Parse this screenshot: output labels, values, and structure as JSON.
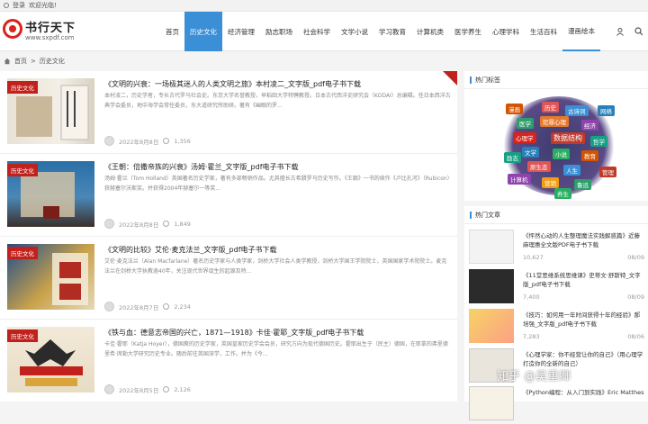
{
  "topbar": {
    "login": "登录",
    "welcome": "欢迎光临!"
  },
  "site": {
    "name": "书行天下",
    "url": "www.sxpdf.com"
  },
  "nav": [
    "首页",
    "历史文化",
    "经济管理",
    "励志职场",
    "社会科学",
    "文学小说",
    "学习教育",
    "计算机类",
    "医学养生",
    "心理学科",
    "生活百科",
    "漫画绘本"
  ],
  "breadcrumb": {
    "home": "首页",
    "current": "历史文化"
  },
  "posts": [
    {
      "category": "历史文化",
      "title": "《文明的兴衰：一场极其迷人的人类文明之旅》本村凌二_文字版_pdf电子书下载",
      "desc": "本村凌二，历史学者，专长古代罗马社会史。东京大学名誉教授，早稻田大学特聘教授。日本古代西洋史研究会（KODAI）总编辑。任日本西洋古典学会委员，地中海学会常任委员，东大道研究所助研。著有《幽眼的罗...",
      "date": "2022年8月8日",
      "views": "1,356"
    },
    {
      "category": "历史文化",
      "title": "《王朝：倍撒帝族的兴衰》汤姆·霍兰_文字版_pdf电子书下载",
      "desc": "汤姆·霍兰（Tom Holland）英国著名历史学家，著有多部畅销作品。尤其擅长古希腊罗马历史写作。《王朝》一书的续作《卢比孔河》（Rubicon）获赫塞尔沃斯奖。并获得2004年赫塞尔一等奖...",
      "date": "2022年8月8日",
      "views": "1,849"
    },
    {
      "category": "历史文化",
      "title": "《文明的比较》艾伦·麦克法兰_文字版_pdf电子书下载",
      "desc": "艾伦·麦克法兰（Alan Macfarlane）著名历史学家与人类学家，剑桥大学社会人类学教授，剑桥大学国王学院院士，英国国家学术院院士。麦克法兰在剑桥大学执教逾40年，关注现代世界诞生的起源及特...",
      "date": "2022年8月7日",
      "views": "2,234"
    },
    {
      "category": "历史文化",
      "title": "《铁与血：德意志帝国的兴亡，1871—1918》卡佳·霍耶_文字版_pdf电子书下载",
      "desc": "卡佳·霍耶（Katja Hoyer），德国裔的历史学家，英国皇家历史学会会员，研究方向为现代德国历史。霍耶出生于（民主）德国，在耶拿的弗里德里希·席勒大学研究历史专业。随后前往英国深学，工作。并为《今...",
      "date": "2022年8月5日",
      "views": "2,126"
    }
  ],
  "sidebar": {
    "tags_title": "热门标签",
    "tags": [
      "历史",
      "古诗词",
      "犯罪心理",
      "医学",
      "经济",
      "心理学",
      "数据结构",
      "哲学",
      "文学",
      "小说",
      "教育",
      "原生态",
      "人生",
      "计算机",
      "营销",
      "鲁迅",
      "管理",
      "励志",
      "网络",
      "漫画",
      "养生"
    ],
    "articles_title": "热门文章",
    "articles": [
      {
        "title": "《怦然心动的人生整理魔法实践解惑篇》近藤麻理惠全文版PDF电子书下载",
        "views": "10,627",
        "date": "08/09"
      },
      {
        "title": "《11堂思维系统思维课》史蒂文·舒斯特_文字版_pdf电子书下载",
        "views": "7,400",
        "date": "08/09"
      },
      {
        "title": "《技巧：如何用一年时间获得十年的经验》郝培强_文字版_pdf电子书下载",
        "views": "7,283",
        "date": "08/06"
      },
      {
        "title": "《心理学家：你不经营让你的自己》（用心理学打造你的全新的自己）",
        "views": "",
        "date": ""
      },
      {
        "title": "《Python编程：从入门到实践》Eric Matthes",
        "views": "",
        "date": ""
      }
    ]
  },
  "watermark": "知乎 @吴重卿",
  "colors": {
    "accent": "#3b8fd6",
    "brand": "#c0211c"
  }
}
